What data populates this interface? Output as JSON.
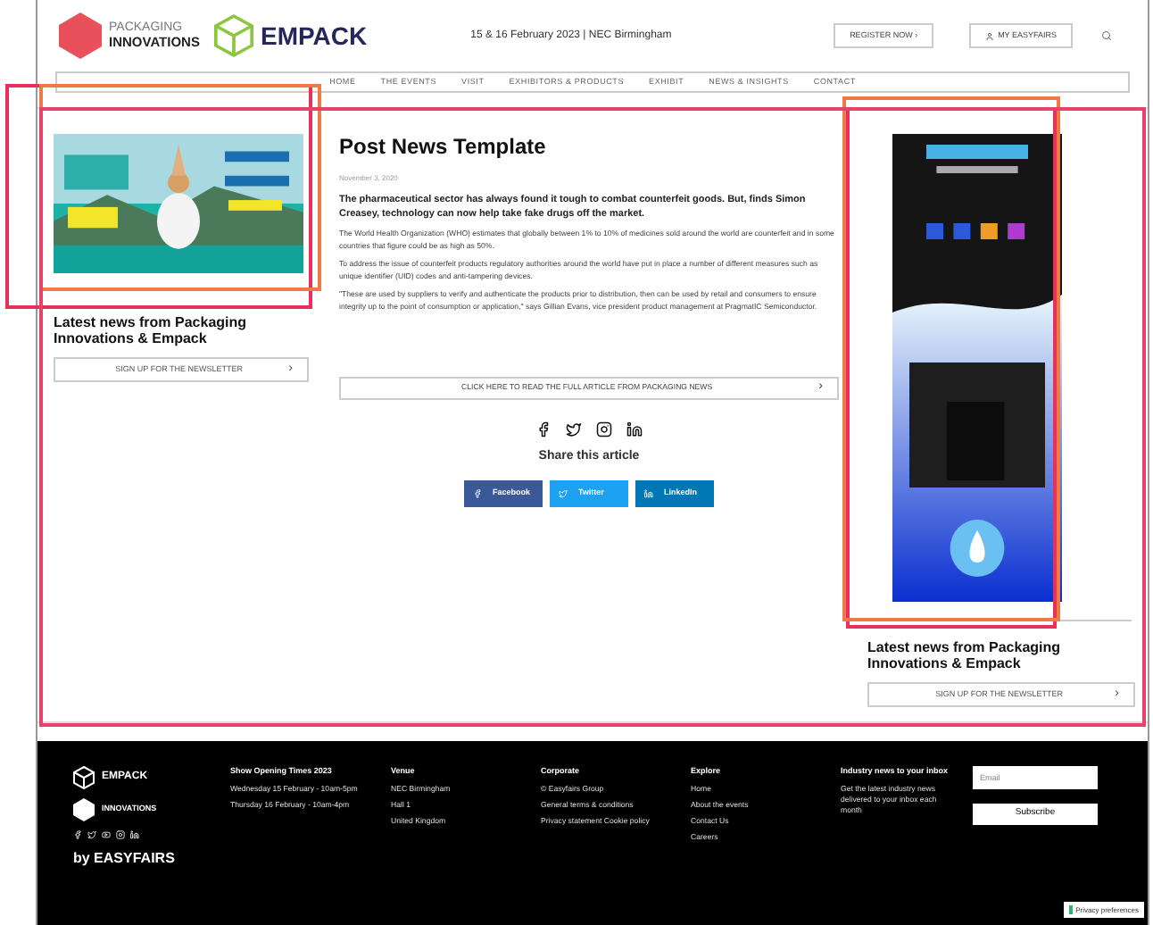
{
  "header": {
    "logo_top": "PACKAGING",
    "logo_bottom": "INNOVATIONS",
    "logo_empack": "EMPACK",
    "event_info": "15 & 16 February 2023 | NEC Birmingham",
    "register_button": "REGISTER NOW ›",
    "account_button": "MY EASYFAIRS",
    "nav": [
      "HOME",
      "THE EVENTS",
      "VISIT",
      "EXHIBITORS & PRODUCTS",
      "EXHIBIT",
      "NEWS & INSIGHTS",
      "CONTACT"
    ]
  },
  "left_column": {
    "heading": "Latest news from Packaging Innovations & Empack",
    "newsletter_button": "SIGN UP FOR THE NEWSLETTER",
    "button_arrow": "›"
  },
  "article": {
    "title": "Post News Template",
    "date": "November 3, 2020",
    "lead": "The pharmaceutical sector has always found it tough to combat counterfeit goods. But, finds Simon Creasey, technology can now help take fake drugs off the market.",
    "paragraphs": [
      "The World Health Organization (WHO) estimates that globally between 1% to 10% of medicines sold around the world are counterfeit and in some countries that figure could be as high as 50%.",
      "To address the issue of counterfeit products regulatory authorities around the world have put in place a number of different measures such as unique identifier (UID) codes and anti-tampering devices.",
      "\"These are used by suppliers to verify and authenticate the products prior to distribution, then can be used by retail and consumers to ensure integrity up to the point of consumption or application,\" says Gillian Evans, vice president product management at PragmatIC Semiconductor."
    ],
    "read_button": "CLICK HERE TO READ THE FULL ARTICLE FROM PACKAGING NEWS",
    "read_arrow": "›",
    "share_heading": "Share this article",
    "share_buttons": [
      {
        "label": "Facebook",
        "color": "#3b5998"
      },
      {
        "label": "Twitter",
        "color": "#1da1f2"
      },
      {
        "label": "LinkedIn",
        "color": "#0077b5"
      }
    ]
  },
  "right_column": {
    "heading": "Latest news from Packaging Innovations & Empack",
    "newsletter_button": "SIGN UP FOR THE NEWSLETTER",
    "button_arrow": "›"
  },
  "footer": {
    "logo_empack": "EMPACK",
    "logo_innovations": "INNOVATIONS",
    "by_line": "by EASYFAIRS",
    "columns": [
      {
        "heading": "Show Opening Times 2023",
        "lines": [
          "Wednesday 15 February - 10am-5pm",
          "Thursday 16 February - 10am-4pm"
        ]
      },
      {
        "heading": "Venue",
        "lines": [
          "NEC Birmingham",
          "Hall 1",
          "United Kingdom"
        ]
      },
      {
        "heading": "Corporate",
        "lines": [
          "© Easyfairs Group",
          "General terms & conditions",
          "Privacy statement Cookie policy"
        ]
      },
      {
        "heading": "Explore",
        "lines": [
          "Home",
          "About the events",
          "Contact Us",
          "Careers"
        ]
      },
      {
        "heading": "Industry news to your inbox",
        "lines": [
          "Get the latest industry news delivered to your inbox each month"
        ]
      }
    ],
    "email_placeholder": "Email",
    "subscribe_button": "Subscribe",
    "privacy_button": "Privacy preferences"
  },
  "highlight_frames": [
    {
      "color": "#e8315a"
    },
    {
      "color": "#f07a45"
    },
    {
      "color": "#e8315a"
    },
    {
      "color": "#f07a45"
    },
    {
      "color": "#e8426a"
    }
  ]
}
